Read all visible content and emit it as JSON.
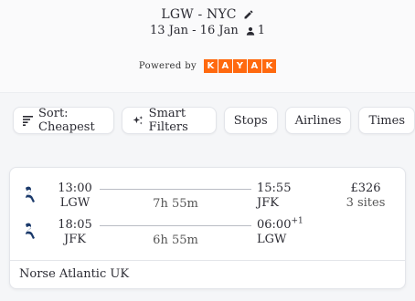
{
  "header": {
    "route": "LGW - NYC",
    "dates": "13 Jan - 16 Jan",
    "passengers": "1",
    "powered_by": "Powered by",
    "kayak_letters": [
      "K",
      "A",
      "Y",
      "A",
      "K"
    ],
    "kayak_color": "#ff690f"
  },
  "filters": {
    "sort_label": "Sort: Cheapest",
    "smart_filters_label": "Smart Filters",
    "stops_label": "Stops",
    "airlines_label": "Airlines",
    "times_label": "Times"
  },
  "result": {
    "outbound": {
      "dep_time": "13:00",
      "dep_code": "LGW",
      "duration": "7h 55m",
      "arr_time": "15:55",
      "arr_code": "JFK"
    },
    "inbound": {
      "dep_time": "18:05",
      "dep_code": "JFK",
      "duration": "6h 55m",
      "arr_time": "06:00",
      "arr_day_offset": "+1",
      "arr_code": "LGW"
    },
    "price": "£326",
    "sites": "3 sites",
    "airline_name": "Norse Atlantic UK",
    "airline_icon": "norse-atlantic-logo-icon",
    "airline_color": "#1b3a6b"
  }
}
